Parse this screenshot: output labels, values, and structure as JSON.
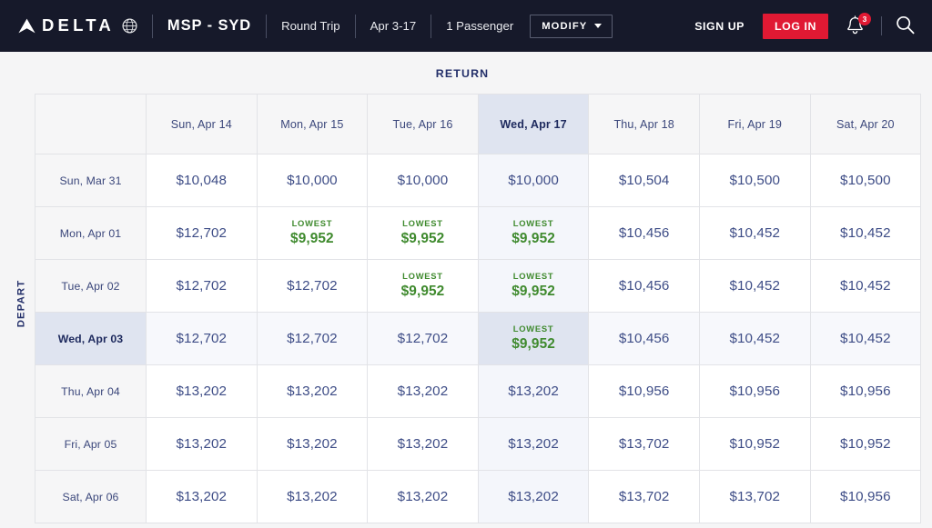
{
  "header": {
    "logo_word": "DELTA",
    "logo_icon": "delta-widget-triangle-icon",
    "skyteam_icon": "skyteam-globe-icon",
    "route": "MSP - SYD",
    "trip_type": "Round Trip",
    "date_range": "Apr 3-17",
    "passengers": "1 Passenger",
    "modify_label": "MODIFY",
    "sign_up_label": "SIGN UP",
    "log_in_label": "LOG IN",
    "notification_count": "3",
    "accent_red": "#e01933",
    "nav_background": "#16192a"
  },
  "main": {
    "return_label": "RETURN",
    "depart_label": "DEPART",
    "lowest_tag": "LOWEST",
    "lowest_color": "#3f8a2e",
    "selected_return_date": "Wed, Apr 17",
    "selected_depart_date": "Wed, Apr 03",
    "return_dates": [
      "Sun, Apr 14",
      "Mon, Apr 15",
      "Tue, Apr 16",
      "Wed, Apr 17",
      "Thu, Apr 18",
      "Fri, Apr 19",
      "Sat, Apr 20"
    ],
    "rows": [
      {
        "depart_date": "Sun, Mar 31",
        "selected": false,
        "fares": [
          {
            "price": "$10,048",
            "lowest": false
          },
          {
            "price": "$10,000",
            "lowest": false
          },
          {
            "price": "$10,000",
            "lowest": false
          },
          {
            "price": "$10,000",
            "lowest": false
          },
          {
            "price": "$10,504",
            "lowest": false
          },
          {
            "price": "$10,500",
            "lowest": false
          },
          {
            "price": "$10,500",
            "lowest": false
          }
        ]
      },
      {
        "depart_date": "Mon, Apr 01",
        "selected": false,
        "fares": [
          {
            "price": "$12,702",
            "lowest": false
          },
          {
            "price": "$9,952",
            "lowest": true
          },
          {
            "price": "$9,952",
            "lowest": true
          },
          {
            "price": "$9,952",
            "lowest": true
          },
          {
            "price": "$10,456",
            "lowest": false
          },
          {
            "price": "$10,452",
            "lowest": false
          },
          {
            "price": "$10,452",
            "lowest": false
          }
        ]
      },
      {
        "depart_date": "Tue, Apr 02",
        "selected": false,
        "fares": [
          {
            "price": "$12,702",
            "lowest": false
          },
          {
            "price": "$12,702",
            "lowest": false
          },
          {
            "price": "$9,952",
            "lowest": true
          },
          {
            "price": "$9,952",
            "lowest": true
          },
          {
            "price": "$10,456",
            "lowest": false
          },
          {
            "price": "$10,452",
            "lowest": false
          },
          {
            "price": "$10,452",
            "lowest": false
          }
        ]
      },
      {
        "depart_date": "Wed, Apr 03",
        "selected": true,
        "fares": [
          {
            "price": "$12,702",
            "lowest": false
          },
          {
            "price": "$12,702",
            "lowest": false
          },
          {
            "price": "$12,702",
            "lowest": false
          },
          {
            "price": "$9,952",
            "lowest": true
          },
          {
            "price": "$10,456",
            "lowest": false
          },
          {
            "price": "$10,452",
            "lowest": false
          },
          {
            "price": "$10,452",
            "lowest": false
          }
        ]
      },
      {
        "depart_date": "Thu, Apr 04",
        "selected": false,
        "fares": [
          {
            "price": "$13,202",
            "lowest": false
          },
          {
            "price": "$13,202",
            "lowest": false
          },
          {
            "price": "$13,202",
            "lowest": false
          },
          {
            "price": "$13,202",
            "lowest": false
          },
          {
            "price": "$10,956",
            "lowest": false
          },
          {
            "price": "$10,956",
            "lowest": false
          },
          {
            "price": "$10,956",
            "lowest": false
          }
        ]
      },
      {
        "depart_date": "Fri, Apr 05",
        "selected": false,
        "fares": [
          {
            "price": "$13,202",
            "lowest": false
          },
          {
            "price": "$13,202",
            "lowest": false
          },
          {
            "price": "$13,202",
            "lowest": false
          },
          {
            "price": "$13,202",
            "lowest": false
          },
          {
            "price": "$13,702",
            "lowest": false
          },
          {
            "price": "$10,952",
            "lowest": false
          },
          {
            "price": "$10,952",
            "lowest": false
          }
        ]
      },
      {
        "depart_date": "Sat, Apr 06",
        "selected": false,
        "fares": [
          {
            "price": "$13,202",
            "lowest": false
          },
          {
            "price": "$13,202",
            "lowest": false
          },
          {
            "price": "$13,202",
            "lowest": false
          },
          {
            "price": "$13,202",
            "lowest": false
          },
          {
            "price": "$13,702",
            "lowest": false
          },
          {
            "price": "$13,702",
            "lowest": false
          },
          {
            "price": "$10,956",
            "lowest": false
          }
        ]
      }
    ]
  }
}
